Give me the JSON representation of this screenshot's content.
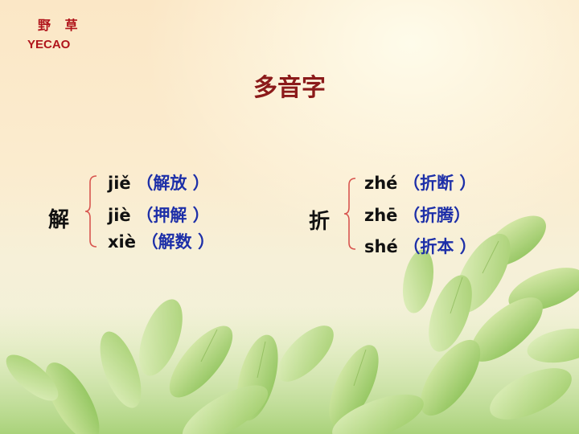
{
  "logo": {
    "chinese": "野 草",
    "english": "YECAO"
  },
  "title": "多音字",
  "groups": [
    {
      "character": "解",
      "readings": [
        {
          "pinyin": "jiě",
          "word": "（解放 ）"
        },
        {
          "pinyin": "jiè",
          "word": "（押解 ）"
        },
        {
          "pinyin": "xiè",
          "word": "（解数 ）"
        }
      ]
    },
    {
      "character": "折",
      "readings": [
        {
          "pinyin": "zhé",
          "word": "（折断 ）"
        },
        {
          "pinyin": "zhē",
          "word": "（折腾）"
        },
        {
          "pinyin": "shé",
          "word": "（折本 ）"
        }
      ]
    }
  ],
  "colors": {
    "title": "#8b1a1a",
    "logo": "#b0141b",
    "pinyin": "#111111",
    "word": "#1d2fa8",
    "bracket": "#d8554f"
  }
}
